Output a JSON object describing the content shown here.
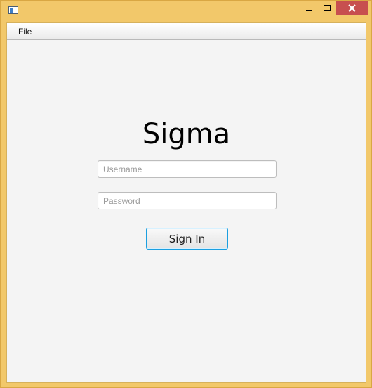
{
  "window": {
    "title": "",
    "controls": {
      "minimize": "minimize-icon",
      "maximize": "maximize-icon",
      "close": "close-icon"
    }
  },
  "menu": {
    "items": [
      {
        "label": "File"
      }
    ]
  },
  "app_title": "Sigma",
  "form": {
    "username": {
      "placeholder": "Username",
      "value": ""
    },
    "password": {
      "placeholder": "Password",
      "value": ""
    },
    "submit_label": "Sign In"
  },
  "colors": {
    "window_frame": "#f2c86a",
    "close_button": "#c74f4f",
    "focus_border": "#1b9fe0",
    "client_background": "#f4f4f4"
  }
}
